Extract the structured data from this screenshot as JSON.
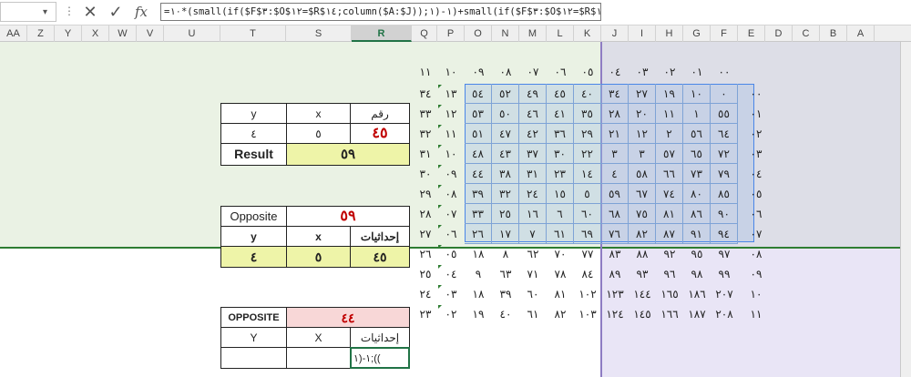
{
  "formula_bar": {
    "cancel": "✕",
    "enter": "✓",
    "fx": "fx",
    "formula": "=١٠*(small(if($F$٣:$O$١٢=$R$١٤;column($A:$J));١)-١)+small(if($F$٣:$O$١٢=$R$١٤;row($١:$١٠));١)-١"
  },
  "columns": [
    "AA",
    "Z",
    "Y",
    "X",
    "W",
    "V",
    "U",
    "T",
    "S",
    "R",
    "Q",
    "P",
    "O",
    "N",
    "M",
    "L",
    "K",
    "J",
    "I",
    "H",
    "G",
    "F",
    "E",
    "D",
    "C",
    "B",
    "A"
  ],
  "selected_column": "R",
  "top_header": [
    "١١",
    "١٠",
    "٠٩",
    "٠٨",
    "٠٧",
    "٠٦",
    "٠٥",
    "٠٤",
    "٠٣",
    "٠٢",
    "٠١",
    "٠٠"
  ],
  "row_labels": [
    "٠٠",
    "٠١",
    "٠٢",
    "٠٣",
    "٠٤",
    "٠٥",
    "٠٦",
    "٠٧",
    "٠٨",
    "٠٩",
    "١٠",
    "١١"
  ],
  "grid_rows": [
    [
      "٣٤",
      "١٣",
      "٥٤",
      "٥٢",
      "٤٩",
      "٤٥",
      "٤٠",
      "٣٤",
      "٢٧",
      "١٩",
      "١٠",
      "٠"
    ],
    [
      "٣٣",
      "١٢",
      "٥٣",
      "٥٠",
      "٤٦",
      "٤١",
      "٣٥",
      "٢٨",
      "٢٠",
      "١١",
      "١",
      "٥٥"
    ],
    [
      "٣٢",
      "١١",
      "٥١",
      "٤٧",
      "٤٢",
      "٣٦",
      "٢٩",
      "٢١",
      "١٢",
      "٢",
      "٥٦",
      "٦٤"
    ],
    [
      "٣١",
      "١٠",
      "٤٨",
      "٤٣",
      "٣٧",
      "٣٠",
      "٢٢",
      "٣",
      "٣",
      "٥٧",
      "٦٥",
      "٧٢"
    ],
    [
      "٣٠",
      "٠٩",
      "٤٤",
      "٣٨",
      "٣١",
      "٢٣",
      "١٤",
      "٤",
      "٥٨",
      "٦٦",
      "٧٣",
      "٧٩"
    ],
    [
      "٢٩",
      "٠٨",
      "٣٩",
      "٣٢",
      "٢٤",
      "١٥",
      "٥",
      "٥٩",
      "٦٧",
      "٧٤",
      "٨٠",
      "٨٥"
    ],
    [
      "٢٨",
      "٠٧",
      "٣٣",
      "٢٥",
      "١٦",
      "٦",
      "٦٠",
      "٦٨",
      "٧٥",
      "٨١",
      "٨٦",
      "٩٠"
    ],
    [
      "٢٧",
      "٠٦",
      "٢٦",
      "١٧",
      "٧",
      "٦١",
      "٦٩",
      "٧٦",
      "٨٢",
      "٨٧",
      "٩١",
      "٩٤"
    ],
    [
      "٢٦",
      "٠٥",
      "١٨",
      "٨",
      "٦٢",
      "٧٠",
      "٧٧",
      "٨٣",
      "٨٨",
      "٩٢",
      "٩٥",
      "٩٧"
    ],
    [
      "٢٥",
      "٠٤",
      "٩",
      "٦٣",
      "٧١",
      "٧٨",
      "٨٤",
      "٨٩",
      "٩٣",
      "٩٦",
      "٩٨",
      "٩٩"
    ],
    [
      "٢٤",
      "٠٣",
      "١٨",
      "٣٩",
      "٦٠",
      "٨١",
      "١٠٢",
      "١٢٣",
      "١٤٤",
      "١٦٥",
      "١٨٦",
      "٢٠٧"
    ],
    [
      "٢٣",
      "٠٢",
      "١٩",
      "٤٠",
      "٦١",
      "٨٢",
      "١٠٣",
      "١٢٤",
      "١٤٥",
      "١٦٦",
      "١٨٧",
      "٢٠٨"
    ]
  ],
  "table1": {
    "h_y": "y",
    "h_x": "x",
    "h_num": "رقم",
    "v_y": "٤",
    "v_x": "٥",
    "v_num": "٤٥",
    "result_label": "Result",
    "result_value": "٥٩"
  },
  "table2": {
    "opposite_label": "Opposite",
    "opposite_value": "٥٩",
    "h_y": "y",
    "h_x": "x",
    "h_coord": "إحداثيات",
    "v_y": "٤",
    "v_x": "٥",
    "v_coord": "٤٥"
  },
  "table3": {
    "opposite_label": "OPPOSITE",
    "opposite_value": "٤٤",
    "h_coord": "إحداثيات",
    "h_y": "Y",
    "h_x": "X",
    "edit_value": "١-(١;(("
  },
  "colors": {
    "green_band": "#eaf2e4",
    "lavender": "#cec6ec",
    "blue_box": "#4a86e8",
    "yellow": "#eef4a8",
    "red_text": "#c00000",
    "pink": "#f8d7d7"
  }
}
